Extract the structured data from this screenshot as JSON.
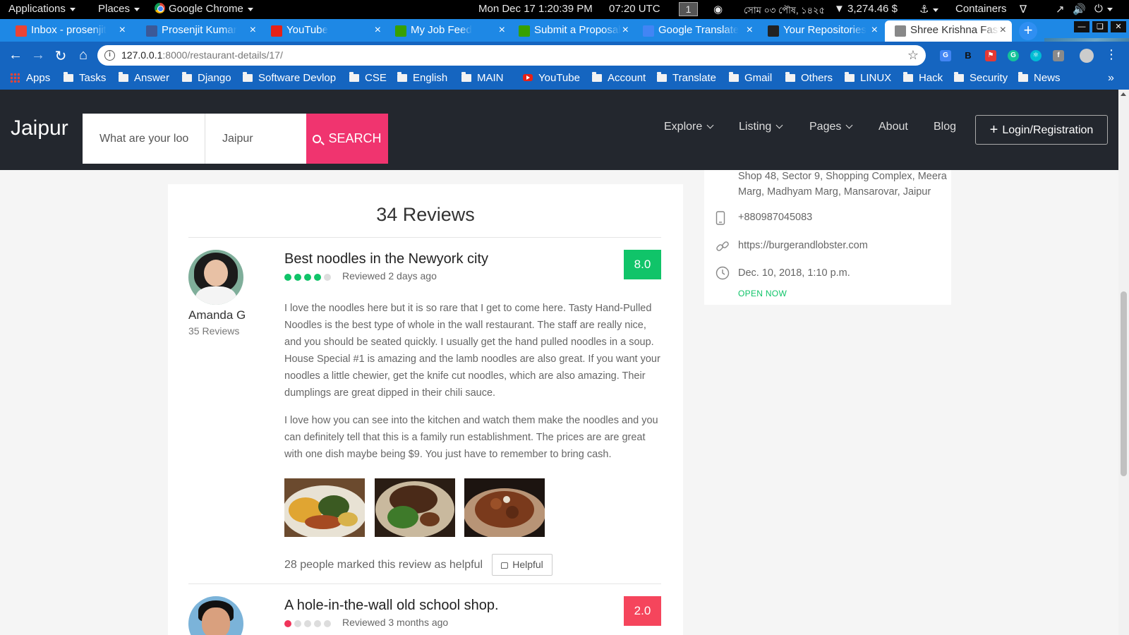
{
  "system_bar": {
    "applications": "Applications",
    "places": "Places",
    "active_app": "Google Chrome",
    "clock": "Mon Dec 17  1:20:39 PM",
    "utc": "07:20 UTC",
    "workspace": "1",
    "bengali_date": "সোম ০৩ পৌষ, ১৪২৫",
    "crypto": "▼ 3,274.46 $",
    "containers": "Containers"
  },
  "tabs": [
    {
      "label": "Inbox - prosenjit",
      "favicon": "gmail-icon",
      "color": "#ea4335"
    },
    {
      "label": "Prosenjit Kumar",
      "favicon": "facebook-icon",
      "color": "#3b5998"
    },
    {
      "label": "YouTube",
      "favicon": "youtube-icon",
      "color": "#e62117"
    },
    {
      "label": "My Job Feed",
      "favicon": "upwork-icon",
      "color": "#37a000"
    },
    {
      "label": "Submit a Proposal",
      "favicon": "upwork-icon",
      "color": "#37a000"
    },
    {
      "label": "Google Translate",
      "favicon": "translate-icon",
      "color": "#4285f4"
    },
    {
      "label": "Your Repositories",
      "favicon": "github-icon",
      "color": "#222222"
    },
    {
      "label": "Shree Krishna Fast",
      "favicon": "page-icon",
      "color": "#888888"
    }
  ],
  "address_bar": {
    "url_host": "127.0.0.1",
    "url_path": ":8000/restaurant-details/17/"
  },
  "bookmarks": [
    {
      "label": "Apps",
      "type": "apps"
    },
    {
      "label": "Tasks",
      "type": "folder"
    },
    {
      "label": "Answer",
      "type": "folder"
    },
    {
      "label": "Django",
      "type": "folder"
    },
    {
      "label": "Software Devlop",
      "type": "folder"
    },
    {
      "label": "CSE",
      "type": "folder"
    },
    {
      "label": "English",
      "type": "folder"
    },
    {
      "label": "MAIN",
      "type": "folder"
    },
    {
      "label": "YouTube",
      "type": "youtube"
    },
    {
      "label": "Account",
      "type": "folder"
    },
    {
      "label": "Translate",
      "type": "folder"
    },
    {
      "label": "Gmail",
      "type": "folder"
    },
    {
      "label": "Others",
      "type": "folder"
    },
    {
      "label": "LINUX",
      "type": "folder"
    },
    {
      "label": "Hack",
      "type": "folder"
    },
    {
      "label": "Security",
      "type": "folder"
    },
    {
      "label": "News",
      "type": "folder"
    }
  ],
  "site": {
    "brand": "Jaipur",
    "search_what_placeholder": "What are your loo",
    "search_where_value": "Jaipur",
    "search_button": "SEARCH",
    "nav": {
      "explore": "Explore",
      "listing": "Listing",
      "pages": "Pages",
      "about": "About",
      "blog": "Blog",
      "login": "Login/Registration"
    }
  },
  "reviews": {
    "heading": "34 Reviews",
    "items": [
      {
        "reviewer": "Amanda G",
        "reviewer_reviews": "35 Reviews",
        "title": "Best noodles in the Newyork city",
        "rating_dots": 4,
        "rating_max": 5,
        "dot_color": "#10c469",
        "date": "Reviewed 2 days ago",
        "score": "8.0",
        "score_color": "#10c469",
        "para1": "I love the noodles here but it is so rare that I get to come here. Tasty Hand-Pulled Noodles is the best type of whole in the wall restaurant. The staff are really nice, and you should be seated quickly. I usually get the hand pulled noodles in a soup. House Special #1 is amazing and the lamb noodles are also great. If you want your noodles a little chewier, get the knife cut noodles, which are also amazing. Their dumplings are great dipped in their chili sauce.",
        "para2": "I love how you can see into the kitchen and watch them make the noodles and you can definitely tell that this is a family run establishment. The prices are are great with one dish maybe being $9. You just have to remember to bring cash.",
        "helpful_text": "28 people marked this review as helpful",
        "helpful_button": "Helpful"
      },
      {
        "title": "A hole-in-the-wall old school shop.",
        "rating_dots": 1,
        "rating_max": 5,
        "dot_color": "#f0345a",
        "date": "Reviewed 3 months ago",
        "score": "2.0",
        "score_color": "#f5455c"
      }
    ]
  },
  "listing_info": {
    "address": "Shop 48, Sector 9, Shopping Complex, Meera Marg, Madhyam Marg, Mansarovar, Jaipur",
    "phone": "+880987045083",
    "website": "https://burgerandlobster.com",
    "hours": "Dec. 10, 2018, 1:10 p.m.",
    "status": "OPEN NOW"
  }
}
